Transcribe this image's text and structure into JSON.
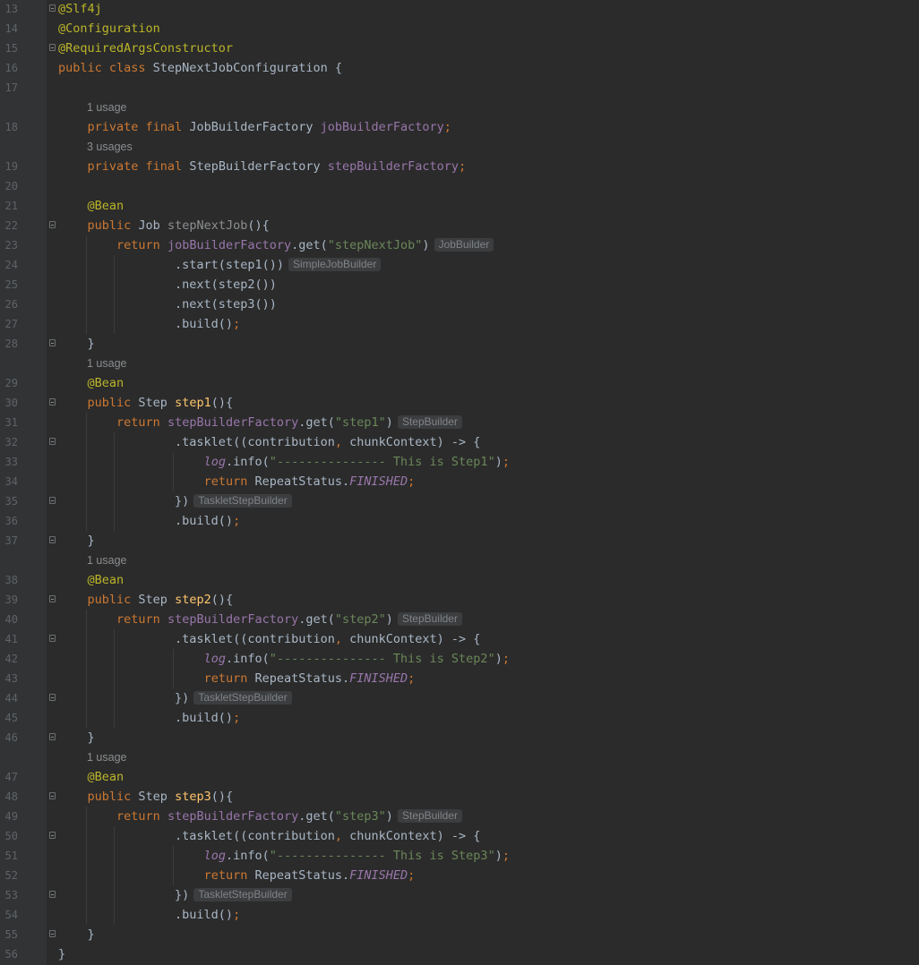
{
  "editor": {
    "language": "Java",
    "theme": "Darcula",
    "colors": {
      "background": "#2b2b2b",
      "gutter": "#313335",
      "keyword": "#cc7832",
      "annotation": "#bbb529",
      "string": "#6a8759",
      "field": "#9876aa",
      "method_declaration": "#ffc66d",
      "default_text": "#a9b7c6",
      "hint": "#808386"
    },
    "lines": [
      {
        "num": "13",
        "fold": true,
        "segs": [
          {
            "c": "a",
            "t": "@Slf4j"
          }
        ]
      },
      {
        "num": "14",
        "segs": [
          {
            "c": "a",
            "t": "@Configuration"
          }
        ]
      },
      {
        "num": "15",
        "fold": true,
        "segs": [
          {
            "c": "a",
            "t": "@RequiredArgsConstructor"
          }
        ]
      },
      {
        "num": "16",
        "segs": [
          {
            "c": "k",
            "t": "public class "
          },
          {
            "c": "d",
            "t": "StepNextJobConfiguration {"
          }
        ]
      },
      {
        "num": "17",
        "segs": []
      },
      {
        "usage": "1 usage"
      },
      {
        "num": "18",
        "segs": [
          {
            "c": "d",
            "t": "    "
          },
          {
            "c": "k",
            "t": "private final "
          },
          {
            "c": "d",
            "t": "JobBuilderFactory "
          },
          {
            "c": "f",
            "t": "jobBuilderFactory"
          },
          {
            "c": "k",
            "t": ";"
          }
        ]
      },
      {
        "usage": "3 usages"
      },
      {
        "num": "19",
        "segs": [
          {
            "c": "d",
            "t": "    "
          },
          {
            "c": "k",
            "t": "private final "
          },
          {
            "c": "d",
            "t": "StepBuilderFactory "
          },
          {
            "c": "f",
            "t": "stepBuilderFactory"
          },
          {
            "c": "k",
            "t": ";"
          }
        ]
      },
      {
        "num": "20",
        "segs": []
      },
      {
        "num": "21",
        "segs": [
          {
            "c": "d",
            "t": "    "
          },
          {
            "c": "a",
            "t": "@Bean"
          }
        ]
      },
      {
        "num": "22",
        "fold": true,
        "segs": [
          {
            "c": "d",
            "t": "    "
          },
          {
            "c": "k",
            "t": "public "
          },
          {
            "c": "d",
            "t": "Job "
          },
          {
            "c": "dim",
            "t": "stepNextJob"
          },
          {
            "c": "d",
            "t": "(){"
          }
        ]
      },
      {
        "num": "23",
        "segs": [
          {
            "c": "d",
            "t": "        "
          },
          {
            "c": "k",
            "t": "return "
          },
          {
            "c": "f",
            "t": "jobBuilderFactory"
          },
          {
            "c": "d",
            "t": ".get("
          },
          {
            "c": "s",
            "t": "\"stepNextJob\""
          },
          {
            "c": "d",
            "t": ")"
          },
          {
            "c": "hint",
            "t": "JobBuilder"
          }
        ]
      },
      {
        "num": "24",
        "segs": [
          {
            "c": "d",
            "t": "                .start(step1())"
          },
          {
            "c": "hint",
            "t": "SimpleJobBuilder"
          }
        ]
      },
      {
        "num": "25",
        "segs": [
          {
            "c": "d",
            "t": "                .next(step2())"
          }
        ]
      },
      {
        "num": "26",
        "segs": [
          {
            "c": "d",
            "t": "                .next(step3())"
          }
        ]
      },
      {
        "num": "27",
        "segs": [
          {
            "c": "d",
            "t": "                .build()"
          },
          {
            "c": "k",
            "t": ";"
          }
        ]
      },
      {
        "num": "28",
        "fold": true,
        "segs": [
          {
            "c": "d",
            "t": "    }"
          }
        ]
      },
      {
        "usage": "1 usage"
      },
      {
        "num": "29",
        "segs": [
          {
            "c": "d",
            "t": "    "
          },
          {
            "c": "a",
            "t": "@Bean"
          }
        ]
      },
      {
        "num": "30",
        "fold": true,
        "segs": [
          {
            "c": "d",
            "t": "    "
          },
          {
            "c": "k",
            "t": "public "
          },
          {
            "c": "d",
            "t": "Step "
          },
          {
            "c": "m",
            "t": "step1"
          },
          {
            "c": "d",
            "t": "(){"
          }
        ]
      },
      {
        "num": "31",
        "segs": [
          {
            "c": "d",
            "t": "        "
          },
          {
            "c": "k",
            "t": "return "
          },
          {
            "c": "f",
            "t": "stepBuilderFactory"
          },
          {
            "c": "d",
            "t": ".get("
          },
          {
            "c": "s",
            "t": "\"step1\""
          },
          {
            "c": "d",
            "t": ")"
          },
          {
            "c": "hint",
            "t": "StepBuilder"
          }
        ]
      },
      {
        "num": "32",
        "fold": true,
        "segs": [
          {
            "c": "d",
            "t": "                .tasklet((contribution"
          },
          {
            "c": "k",
            "t": ", "
          },
          {
            "c": "d",
            "t": "chunkContext) -> {"
          }
        ]
      },
      {
        "num": "33",
        "segs": [
          {
            "c": "d",
            "t": "                    "
          },
          {
            "c": "fi",
            "t": "log"
          },
          {
            "c": "d",
            "t": ".info("
          },
          {
            "c": "s",
            "t": "\"--------------- This is Step1\""
          },
          {
            "c": "d",
            "t": ")"
          },
          {
            "c": "k",
            "t": ";"
          }
        ]
      },
      {
        "num": "34",
        "segs": [
          {
            "c": "d",
            "t": "                    "
          },
          {
            "c": "k",
            "t": "return "
          },
          {
            "c": "d",
            "t": "RepeatStatus."
          },
          {
            "c": "fi",
            "t": "FINISHED"
          },
          {
            "c": "k",
            "t": ";"
          }
        ]
      },
      {
        "num": "35",
        "fold": true,
        "segs": [
          {
            "c": "d",
            "t": "                })"
          },
          {
            "c": "hint",
            "t": "TaskletStepBuilder"
          }
        ]
      },
      {
        "num": "36",
        "segs": [
          {
            "c": "d",
            "t": "                .build()"
          },
          {
            "c": "k",
            "t": ";"
          }
        ]
      },
      {
        "num": "37",
        "fold": true,
        "segs": [
          {
            "c": "d",
            "t": "    }"
          }
        ]
      },
      {
        "usage": "1 usage"
      },
      {
        "num": "38",
        "segs": [
          {
            "c": "d",
            "t": "    "
          },
          {
            "c": "a",
            "t": "@Bean"
          }
        ]
      },
      {
        "num": "39",
        "fold": true,
        "segs": [
          {
            "c": "d",
            "t": "    "
          },
          {
            "c": "k",
            "t": "public "
          },
          {
            "c": "d",
            "t": "Step "
          },
          {
            "c": "m",
            "t": "step2"
          },
          {
            "c": "d",
            "t": "(){"
          }
        ]
      },
      {
        "num": "40",
        "segs": [
          {
            "c": "d",
            "t": "        "
          },
          {
            "c": "k",
            "t": "return "
          },
          {
            "c": "f",
            "t": "stepBuilderFactory"
          },
          {
            "c": "d",
            "t": ".get("
          },
          {
            "c": "s",
            "t": "\"step2\""
          },
          {
            "c": "d",
            "t": ")"
          },
          {
            "c": "hint",
            "t": "StepBuilder"
          }
        ]
      },
      {
        "num": "41",
        "fold": true,
        "segs": [
          {
            "c": "d",
            "t": "                .tasklet((contribution"
          },
          {
            "c": "k",
            "t": ", "
          },
          {
            "c": "d",
            "t": "chunkContext) -> {"
          }
        ]
      },
      {
        "num": "42",
        "segs": [
          {
            "c": "d",
            "t": "                    "
          },
          {
            "c": "fi",
            "t": "log"
          },
          {
            "c": "d",
            "t": ".info("
          },
          {
            "c": "s",
            "t": "\"--------------- This is Step2\""
          },
          {
            "c": "d",
            "t": ")"
          },
          {
            "c": "k",
            "t": ";"
          }
        ]
      },
      {
        "num": "43",
        "segs": [
          {
            "c": "d",
            "t": "                    "
          },
          {
            "c": "k",
            "t": "return "
          },
          {
            "c": "d",
            "t": "RepeatStatus."
          },
          {
            "c": "fi",
            "t": "FINISHED"
          },
          {
            "c": "k",
            "t": ";"
          }
        ]
      },
      {
        "num": "44",
        "fold": true,
        "segs": [
          {
            "c": "d",
            "t": "                })"
          },
          {
            "c": "hint",
            "t": "TaskletStepBuilder"
          }
        ]
      },
      {
        "num": "45",
        "segs": [
          {
            "c": "d",
            "t": "                .build()"
          },
          {
            "c": "k",
            "t": ";"
          }
        ]
      },
      {
        "num": "46",
        "fold": true,
        "segs": [
          {
            "c": "d",
            "t": "    }"
          }
        ]
      },
      {
        "usage": "1 usage"
      },
      {
        "num": "47",
        "segs": [
          {
            "c": "d",
            "t": "    "
          },
          {
            "c": "a",
            "t": "@Bean"
          }
        ]
      },
      {
        "num": "48",
        "fold": true,
        "segs": [
          {
            "c": "d",
            "t": "    "
          },
          {
            "c": "k",
            "t": "public "
          },
          {
            "c": "d",
            "t": "Step "
          },
          {
            "c": "m",
            "t": "step3"
          },
          {
            "c": "d",
            "t": "(){"
          }
        ]
      },
      {
        "num": "49",
        "segs": [
          {
            "c": "d",
            "t": "        "
          },
          {
            "c": "k",
            "t": "return "
          },
          {
            "c": "f",
            "t": "stepBuilderFactory"
          },
          {
            "c": "d",
            "t": ".get("
          },
          {
            "c": "s",
            "t": "\"step3\""
          },
          {
            "c": "d",
            "t": ")"
          },
          {
            "c": "hint",
            "t": "StepBuilder"
          }
        ]
      },
      {
        "num": "50",
        "fold": true,
        "segs": [
          {
            "c": "d",
            "t": "                .tasklet((contribution"
          },
          {
            "c": "k",
            "t": ", "
          },
          {
            "c": "d",
            "t": "chunkContext) -> {"
          }
        ]
      },
      {
        "num": "51",
        "segs": [
          {
            "c": "d",
            "t": "                    "
          },
          {
            "c": "fi",
            "t": "log"
          },
          {
            "c": "d",
            "t": ".info("
          },
          {
            "c": "s",
            "t": "\"--------------- This is Step3\""
          },
          {
            "c": "d",
            "t": ")"
          },
          {
            "c": "k",
            "t": ";"
          }
        ]
      },
      {
        "num": "52",
        "segs": [
          {
            "c": "d",
            "t": "                    "
          },
          {
            "c": "k",
            "t": "return "
          },
          {
            "c": "d",
            "t": "RepeatStatus."
          },
          {
            "c": "fi",
            "t": "FINISHED"
          },
          {
            "c": "k",
            "t": ";"
          }
        ]
      },
      {
        "num": "53",
        "fold": true,
        "segs": [
          {
            "c": "d",
            "t": "                })"
          },
          {
            "c": "hint",
            "t": "TaskletStepBuilder"
          }
        ]
      },
      {
        "num": "54",
        "segs": [
          {
            "c": "d",
            "t": "                .build()"
          },
          {
            "c": "k",
            "t": ";"
          }
        ]
      },
      {
        "num": "55",
        "fold": true,
        "segs": [
          {
            "c": "d",
            "t": "    }"
          }
        ]
      },
      {
        "num": "56",
        "segs": [
          {
            "c": "d",
            "t": "}"
          }
        ]
      }
    ]
  }
}
